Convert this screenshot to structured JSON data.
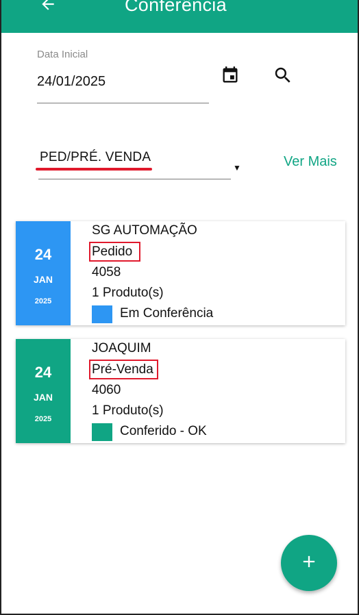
{
  "appbar": {
    "title": "Conferência",
    "back_icon": "arrow-left-icon",
    "color": "#10a584"
  },
  "filters": {
    "date_label": "Data Inicial",
    "date_value": "24/01/2025",
    "calendar_icon": "calendar-icon",
    "search_icon": "search-icon",
    "type_select_value": "PED/PRÉ. VENDA",
    "more_link": "Ver Mais"
  },
  "cards": [
    {
      "day": "24",
      "month": "JAN",
      "year": "2025",
      "date_color": "#2d96f3",
      "customer": "SG AUTOMAÇÃO",
      "type": "Pedido",
      "number": "4058",
      "products": "1 Produto(s)",
      "status": "Em Conferência",
      "status_color": "#2d96f3"
    },
    {
      "day": "24",
      "month": "JAN",
      "year": "2025",
      "date_color": "#10a584",
      "customer": "JOAQUIM",
      "type": "Pré-Venda",
      "number": "4060",
      "products": "1 Produto(s)",
      "status": "Conferido - OK",
      "status_color": "#10a584"
    }
  ],
  "fab": {
    "icon": "plus-icon"
  }
}
